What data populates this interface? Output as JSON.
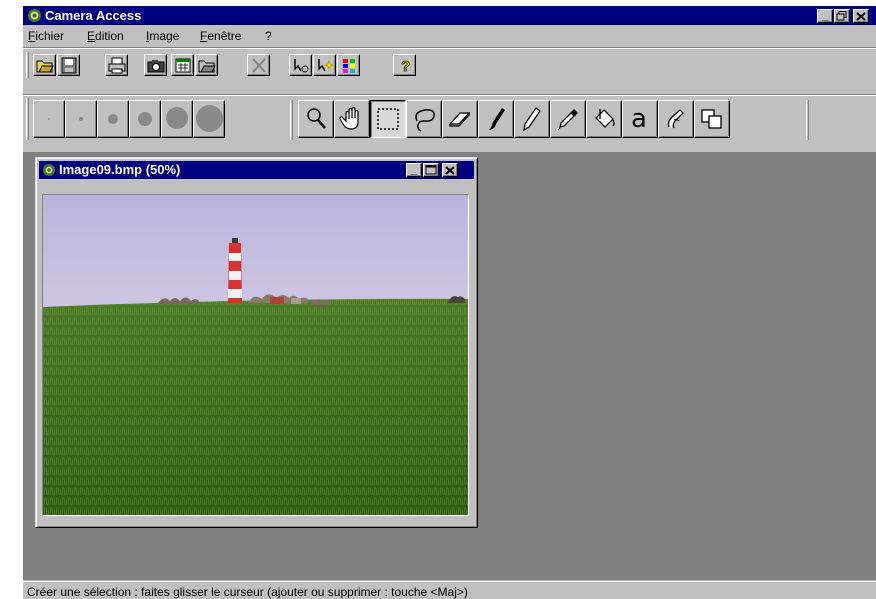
{
  "app": {
    "title": "Camera Access"
  },
  "window_controls": {
    "minimize": "_",
    "restore": "3",
    "close": "×"
  },
  "menu": [
    {
      "label": "Fichier"
    },
    {
      "label": "Edition"
    },
    {
      "label": "Image"
    },
    {
      "label": "Fenêtre"
    },
    {
      "label": "?"
    }
  ],
  "toolbar1": {
    "icons": [
      "open-folder-icon",
      "save-icon",
      "print-icon",
      "camera-icon",
      "calendar-icon",
      "open-batch-icon",
      "delete-icon",
      "tool-arrow-icon",
      "sparkle-icon",
      "color-grid-icon",
      "help-icon"
    ]
  },
  "toolbar2": {
    "brush_sizes": [
      "size-1",
      "size-2",
      "size-3",
      "size-4",
      "size-5",
      "size-6"
    ],
    "tools": [
      "zoom-icon",
      "hand-icon",
      "rect-select-icon",
      "lasso-icon",
      "eraser-icon",
      "brush-icon",
      "pencil-icon",
      "eyedropper-icon",
      "fill-bucket-icon",
      "text-icon",
      "clone-icon",
      "layers-icon"
    ],
    "text_tool_glyph": "a",
    "selected_tool": "rect-select-icon"
  },
  "document": {
    "title": "Image09.bmp (50%)"
  },
  "status": {
    "text": "Créer une sélection : faites glisser le curseur (ajouter ou supprimer : touche <Maj>)"
  }
}
